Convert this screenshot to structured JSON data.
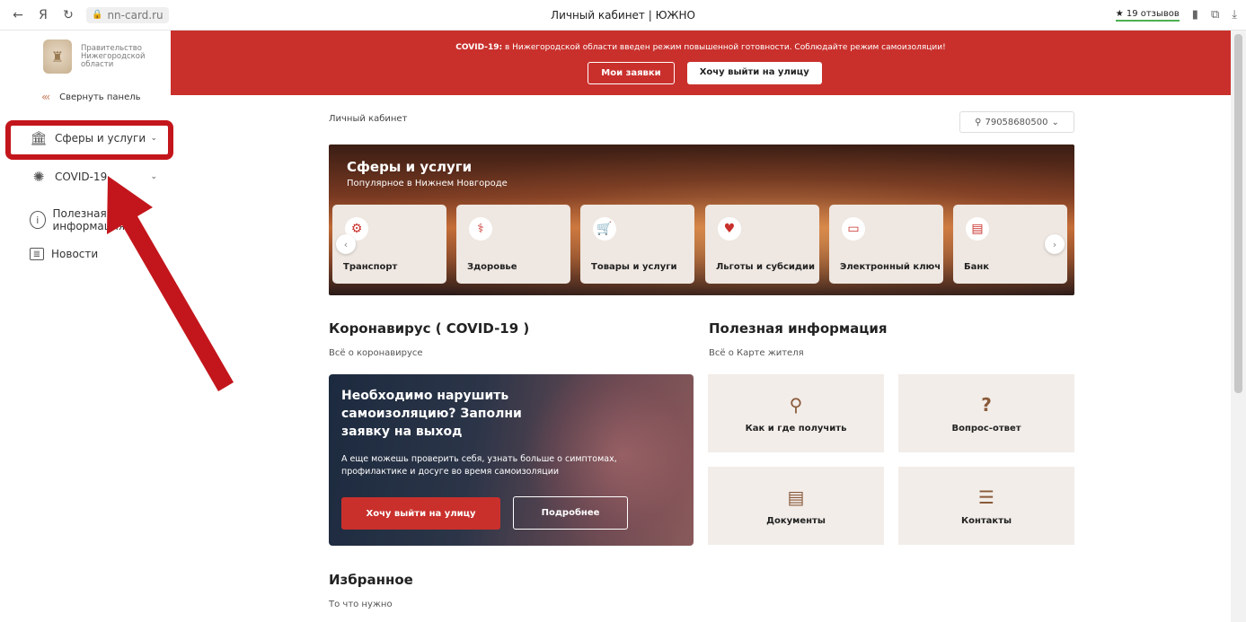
{
  "browser": {
    "back_icon": "←",
    "yandex_icon": "Я",
    "reload_icon": "↻",
    "url": "nn-card.ru",
    "title": "Личный кабинет | ЮЖНО",
    "reviews": "★ 19 отзывов"
  },
  "sidebar": {
    "logo_text": "Правительство Нижегородской области",
    "collapse_label": "Свернуть панель",
    "items": [
      {
        "label": "Сферы и услуги",
        "icon": "building-icon"
      },
      {
        "label": "COVID-19",
        "icon": "virus-icon"
      },
      {
        "label": "Полезная информация",
        "icon": "info-icon"
      },
      {
        "label": "Новости",
        "icon": "news-icon"
      }
    ]
  },
  "alert": {
    "prefix": "COVID-19:",
    "message": " в Нижегородской области введен режим повышенной готовности. Соблюдайте режим самоизоляции!",
    "btn_requests": "Мои заявки",
    "btn_go_out": "Хочу выйти на улицу",
    "color": "#c9302c"
  },
  "main": {
    "breadcrumb": "Личный кабинет",
    "user_phone": "79058680500",
    "hero": {
      "title": "Сферы и услуги",
      "subtitle": "Популярное в Нижнем Новгороде",
      "cards": [
        "Транспорт",
        "Здоровье",
        "Товары и услуги",
        "Льготы и субсидии",
        "Электронный ключ",
        "Банк"
      ]
    },
    "covid": {
      "title": "Коронавирус ( COVID-19 )",
      "subtitle": "Всё о коронавирусе",
      "card_title": "Необходимо нарушить самоизоляцию? Заполни заявку на выход",
      "card_text": "А еще можешь проверить себя, узнать больше о симптомах, профилактике и досуге во время самоизоляции",
      "btn_go_out": "Хочу выйти на улицу",
      "btn_more": "Подробнее"
    },
    "useful": {
      "title": "Полезная информация",
      "subtitle": "Всё о Карте жителя",
      "tiles": [
        {
          "label": "Как и где получить",
          "icon": "location-pin-icon"
        },
        {
          "label": "Вопрос-ответ",
          "icon": "question-icon"
        },
        {
          "label": "Документы",
          "icon": "document-icon"
        },
        {
          "label": "Контакты",
          "icon": "chat-icon"
        }
      ]
    },
    "favorites": {
      "title": "Избранное",
      "subtitle": "То что нужно"
    }
  }
}
